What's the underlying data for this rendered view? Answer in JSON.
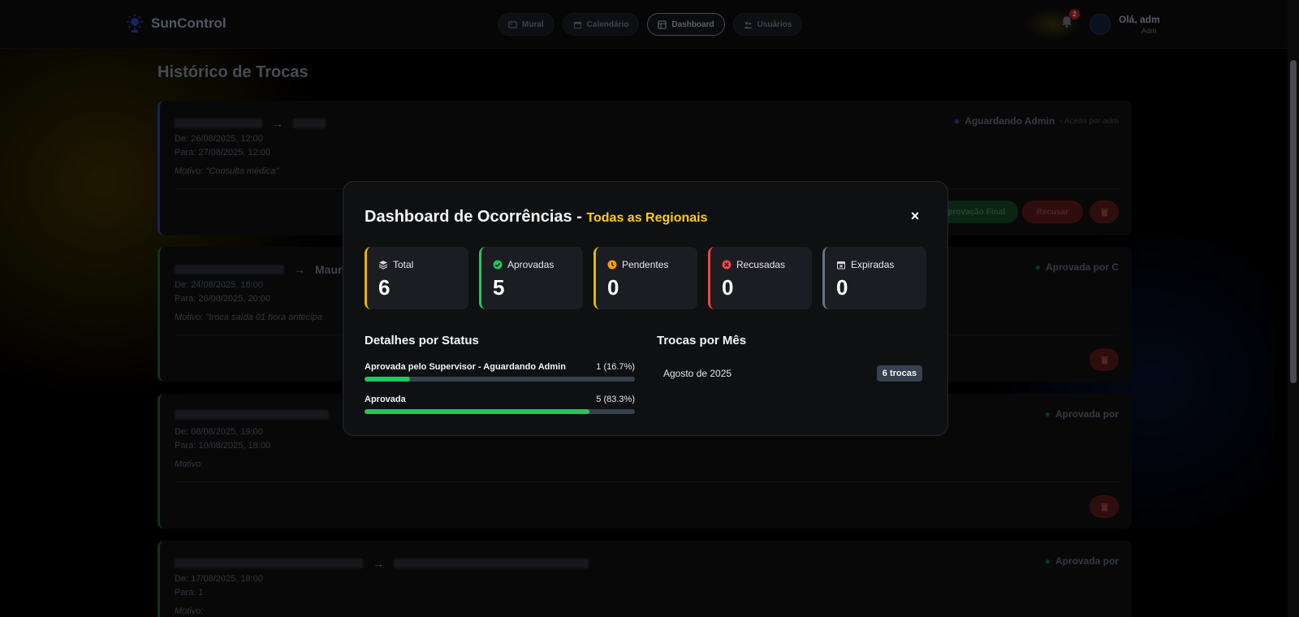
{
  "app": {
    "name": "SunControl"
  },
  "nav": {
    "links": [
      {
        "label": "Mural",
        "icon": "image-icon",
        "active": false
      },
      {
        "label": "Calendário",
        "icon": "calendar-icon",
        "active": false
      },
      {
        "label": "Dashboard",
        "icon": "dashboard-icon",
        "active": true
      },
      {
        "label": "Usuários",
        "icon": "users-icon",
        "active": false
      }
    ],
    "notifications_count": "2",
    "greeting": "Olá, adm",
    "role": "Adm"
  },
  "page": {
    "title": "Histórico de Trocas",
    "cards": [
      {
        "to_name": "",
        "from": "De: 26/08/2025, 12:00",
        "to": "Para: 27/08/2025, 12:00",
        "motivo": "Motivo: \"Consulta médica\"",
        "status": "Aguardando Admin",
        "accepted_by": "- Aceito por adm",
        "approve_label": "Aprovação Final",
        "reject_label": "Recusar"
      },
      {
        "to_name": "Mauri",
        "from": "De: 24/08/2025, 18:00",
        "to": "Para: 26/08/2025, 20:00",
        "motivo": "Motivo: \"troca saída 01 hora antecipa",
        "status": "Aprovada por C"
      },
      {
        "from": "De: 08/08/2025, 19:00",
        "to": "Para: 10/08/2025, 18:00",
        "motivo": "Motivo:",
        "status": "Aprovada por"
      },
      {
        "from": "De: 17/08/2025, 18:00",
        "to": "Para: 1",
        "motivo": "Motivo:",
        "status": "Aprovada por"
      }
    ]
  },
  "modal": {
    "title": "Dashboard de Ocorrências - ",
    "scope": "Todas as Regionais",
    "close_label": "×",
    "stats": [
      {
        "label": "Total",
        "value": "6",
        "icon": "layers-icon",
        "color": "#eab308"
      },
      {
        "label": "Aprovadas",
        "value": "5",
        "icon": "check-circle-icon",
        "color": "#22c55e"
      },
      {
        "label": "Pendentes",
        "value": "0",
        "icon": "clock-icon",
        "color": "#eab308"
      },
      {
        "label": "Recusadas",
        "value": "0",
        "icon": "x-circle-icon",
        "color": "#ef4444"
      },
      {
        "label": "Expiradas",
        "value": "0",
        "icon": "calendar-x-icon",
        "color": "#6b7280"
      }
    ],
    "status_details": {
      "title": "Detalhes por Status",
      "rows": [
        {
          "label": "Aprovada pelo Supervisor - Aguardando Admin",
          "count": "1 (16.7%)",
          "fraction": 0.167
        },
        {
          "label": "Aprovada",
          "count": "5 (83.3%)",
          "fraction": 0.833
        }
      ]
    },
    "by_month": {
      "title": "Trocas por Mês",
      "rows": [
        {
          "label": "Agosto de 2025",
          "badge": "6 trocas"
        }
      ]
    }
  }
}
